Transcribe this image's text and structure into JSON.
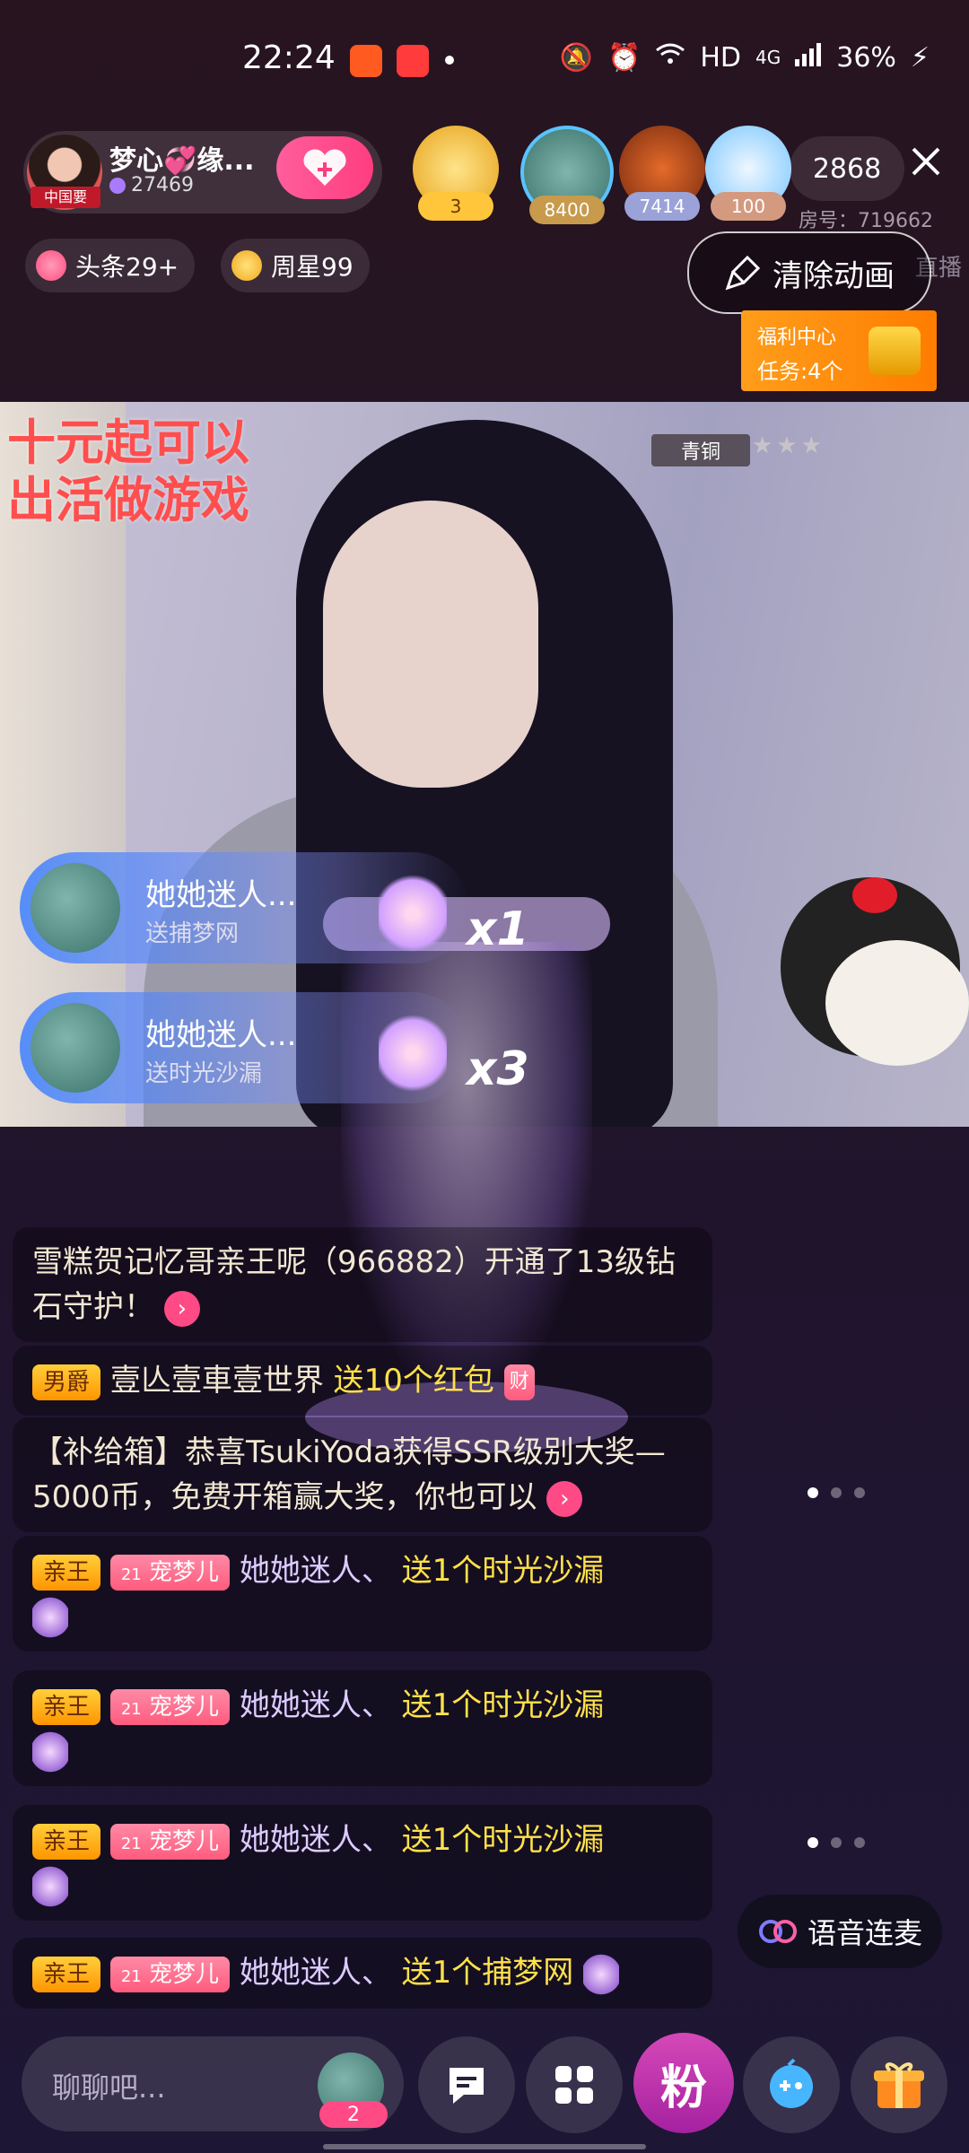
{
  "status_bar": {
    "time": "22:24",
    "network": "HD",
    "signal": "4G",
    "battery": "36%"
  },
  "host": {
    "name": "梦心💞缘...",
    "fans": "27469",
    "avatar_caption": "中国要"
  },
  "viewers": [
    {
      "badge": "3",
      "color": "#ffc63b"
    },
    {
      "badge": "8400",
      "color": "#c79a4c"
    },
    {
      "badge": "7414",
      "color": "#9aa2d8"
    },
    {
      "badge": "100",
      "color": "#d39a7f"
    }
  ],
  "viewer_count": "2868",
  "room_no": "房号：719662",
  "pills": {
    "headline": "头条29+",
    "week_star": "周星99"
  },
  "clear_animation": "清除动画",
  "hidden_tag": "直播",
  "welfare": {
    "title": "福利中心",
    "tasks": "任务:4个"
  },
  "video": {
    "promo_line1": "十元起可以",
    "promo_line2": "出活做游戏",
    "rank": "青铜",
    "stars": "★★★"
  },
  "gift_banners": [
    {
      "name": "她她迷人...",
      "desc": "送捕梦网",
      "count": "x1"
    },
    {
      "name": "她她迷人...",
      "desc": "送时光沙漏",
      "count": "x3"
    }
  ],
  "chat": {
    "msg1": "雪糕贺记忆哥亲王呢（966882）开通了13级钻石守护！",
    "msg2_tag": "男爵",
    "msg2_user": "壹亾壹車壹世界",
    "msg2_text": "送10个红包",
    "msg2_badge": "财",
    "msg3": "【补给箱】恭喜TsukiYoda获得SSR级别大奖—5000币，免费开箱赢大奖，你也可以",
    "gift_rows": [
      {
        "rank": "亲王",
        "level": "21",
        "fan": "宠梦儿",
        "user": "她她迷人、",
        "gift": "送1个时光沙漏"
      },
      {
        "rank": "亲王",
        "level": "21",
        "fan": "宠梦儿",
        "user": "她她迷人、",
        "gift": "送1个时光沙漏"
      },
      {
        "rank": "亲王",
        "level": "21",
        "fan": "宠梦儿",
        "user": "她她迷人、",
        "gift": "送1个时光沙漏"
      },
      {
        "rank": "亲王",
        "level": "21",
        "fan": "宠梦儿",
        "user": "她她迷人、",
        "gift": "送1个捕梦网"
      }
    ]
  },
  "voice_button": "语音连麦",
  "bottom": {
    "input_placeholder": "聊聊吧...",
    "input_badge": "2",
    "fan_button": "粉"
  },
  "icons": [
    "close-icon",
    "follow-heart-icon",
    "broom-icon",
    "treasure-chest-icon",
    "chat-icon",
    "apps-icon",
    "game-icon",
    "gift-icon",
    "voice-link-icon"
  ]
}
